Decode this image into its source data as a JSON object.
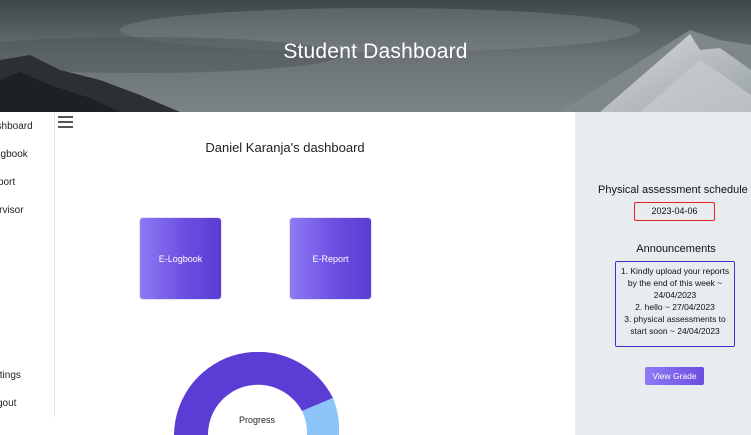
{
  "banner": {
    "title": "Student Dashboard"
  },
  "sidebar": {
    "items": [
      {
        "label": "ashboard"
      },
      {
        "label": "ogbook"
      },
      {
        "label": "port"
      },
      {
        "label": "pervisor"
      },
      {
        "label": "ttings"
      },
      {
        "label": "gout"
      }
    ]
  },
  "main": {
    "title": "Daniel Karanja's dashboard",
    "cards": [
      {
        "label": "E-Logbook"
      },
      {
        "label": "E-Report"
      }
    ],
    "progress": {
      "label": "Progress"
    }
  },
  "right": {
    "schedule_title": "Physical assessment schedule",
    "schedule_date": "2023-04-06",
    "announcements_title": "Announcements",
    "announcements": [
      "1. Kindly upload your reports by the end of this week ~ 24/04/2023",
      "2. hello ~ 27/04/2023",
      "3. physical assessments to start soon ~ 24/04/2023"
    ],
    "grade_button": "View Grade"
  },
  "colors": {
    "accent": "#6b4fe0",
    "progress_main": "#5b3cd4",
    "progress_rest": "#8ec5f9",
    "schedule_border": "#e02424",
    "announcement_border": "#3b35c7",
    "panel_bg": "#e9ecef"
  },
  "icons": {
    "menu": "hamburger-menu-icon"
  }
}
